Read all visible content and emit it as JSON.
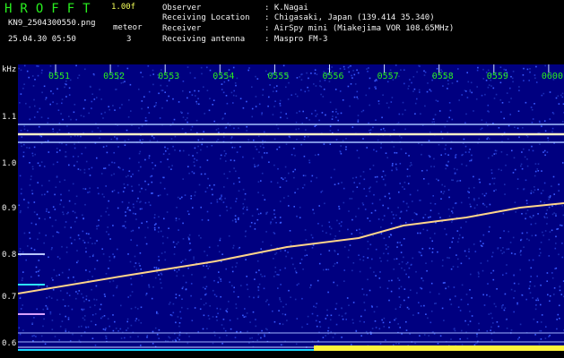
{
  "header": {
    "brand": "HROFFT",
    "version": "1.00f",
    "filename": "KN9_2504300550.png",
    "datetime": "25.04.30 05:50",
    "meteor_label": "meteor",
    "meteor_count": "3",
    "info": [
      {
        "label": "Observer",
        "value": ": K.Nagai"
      },
      {
        "label": "Receiving Location",
        "value": ": Chigasaki, Japan (139.414 35.340)"
      },
      {
        "label": "Receiver",
        "value": ": AirSpy mini (Miakejima VOR 108.65MHz)"
      },
      {
        "label": "Receiving antenna",
        "value": ": Maspro FM-3"
      }
    ]
  },
  "spectrogram": {
    "freq_unit": "kHz",
    "freq_ticks": [
      "1.1",
      "1.0",
      "0.9",
      "0.8",
      "0.7",
      "0.6"
    ],
    "time_ticks": [
      "0551",
      "0552",
      "0553",
      "0554",
      "0555",
      "0556",
      "0557",
      "0558",
      "0559",
      "0600"
    ],
    "colors": {
      "label_green": "#29f01f",
      "text_white": "#f2f2f2",
      "yellow": "#f4ff5a",
      "background": "#000080",
      "cyan_level": "#18d8ff",
      "yellow_level": "#fff23a"
    }
  }
}
